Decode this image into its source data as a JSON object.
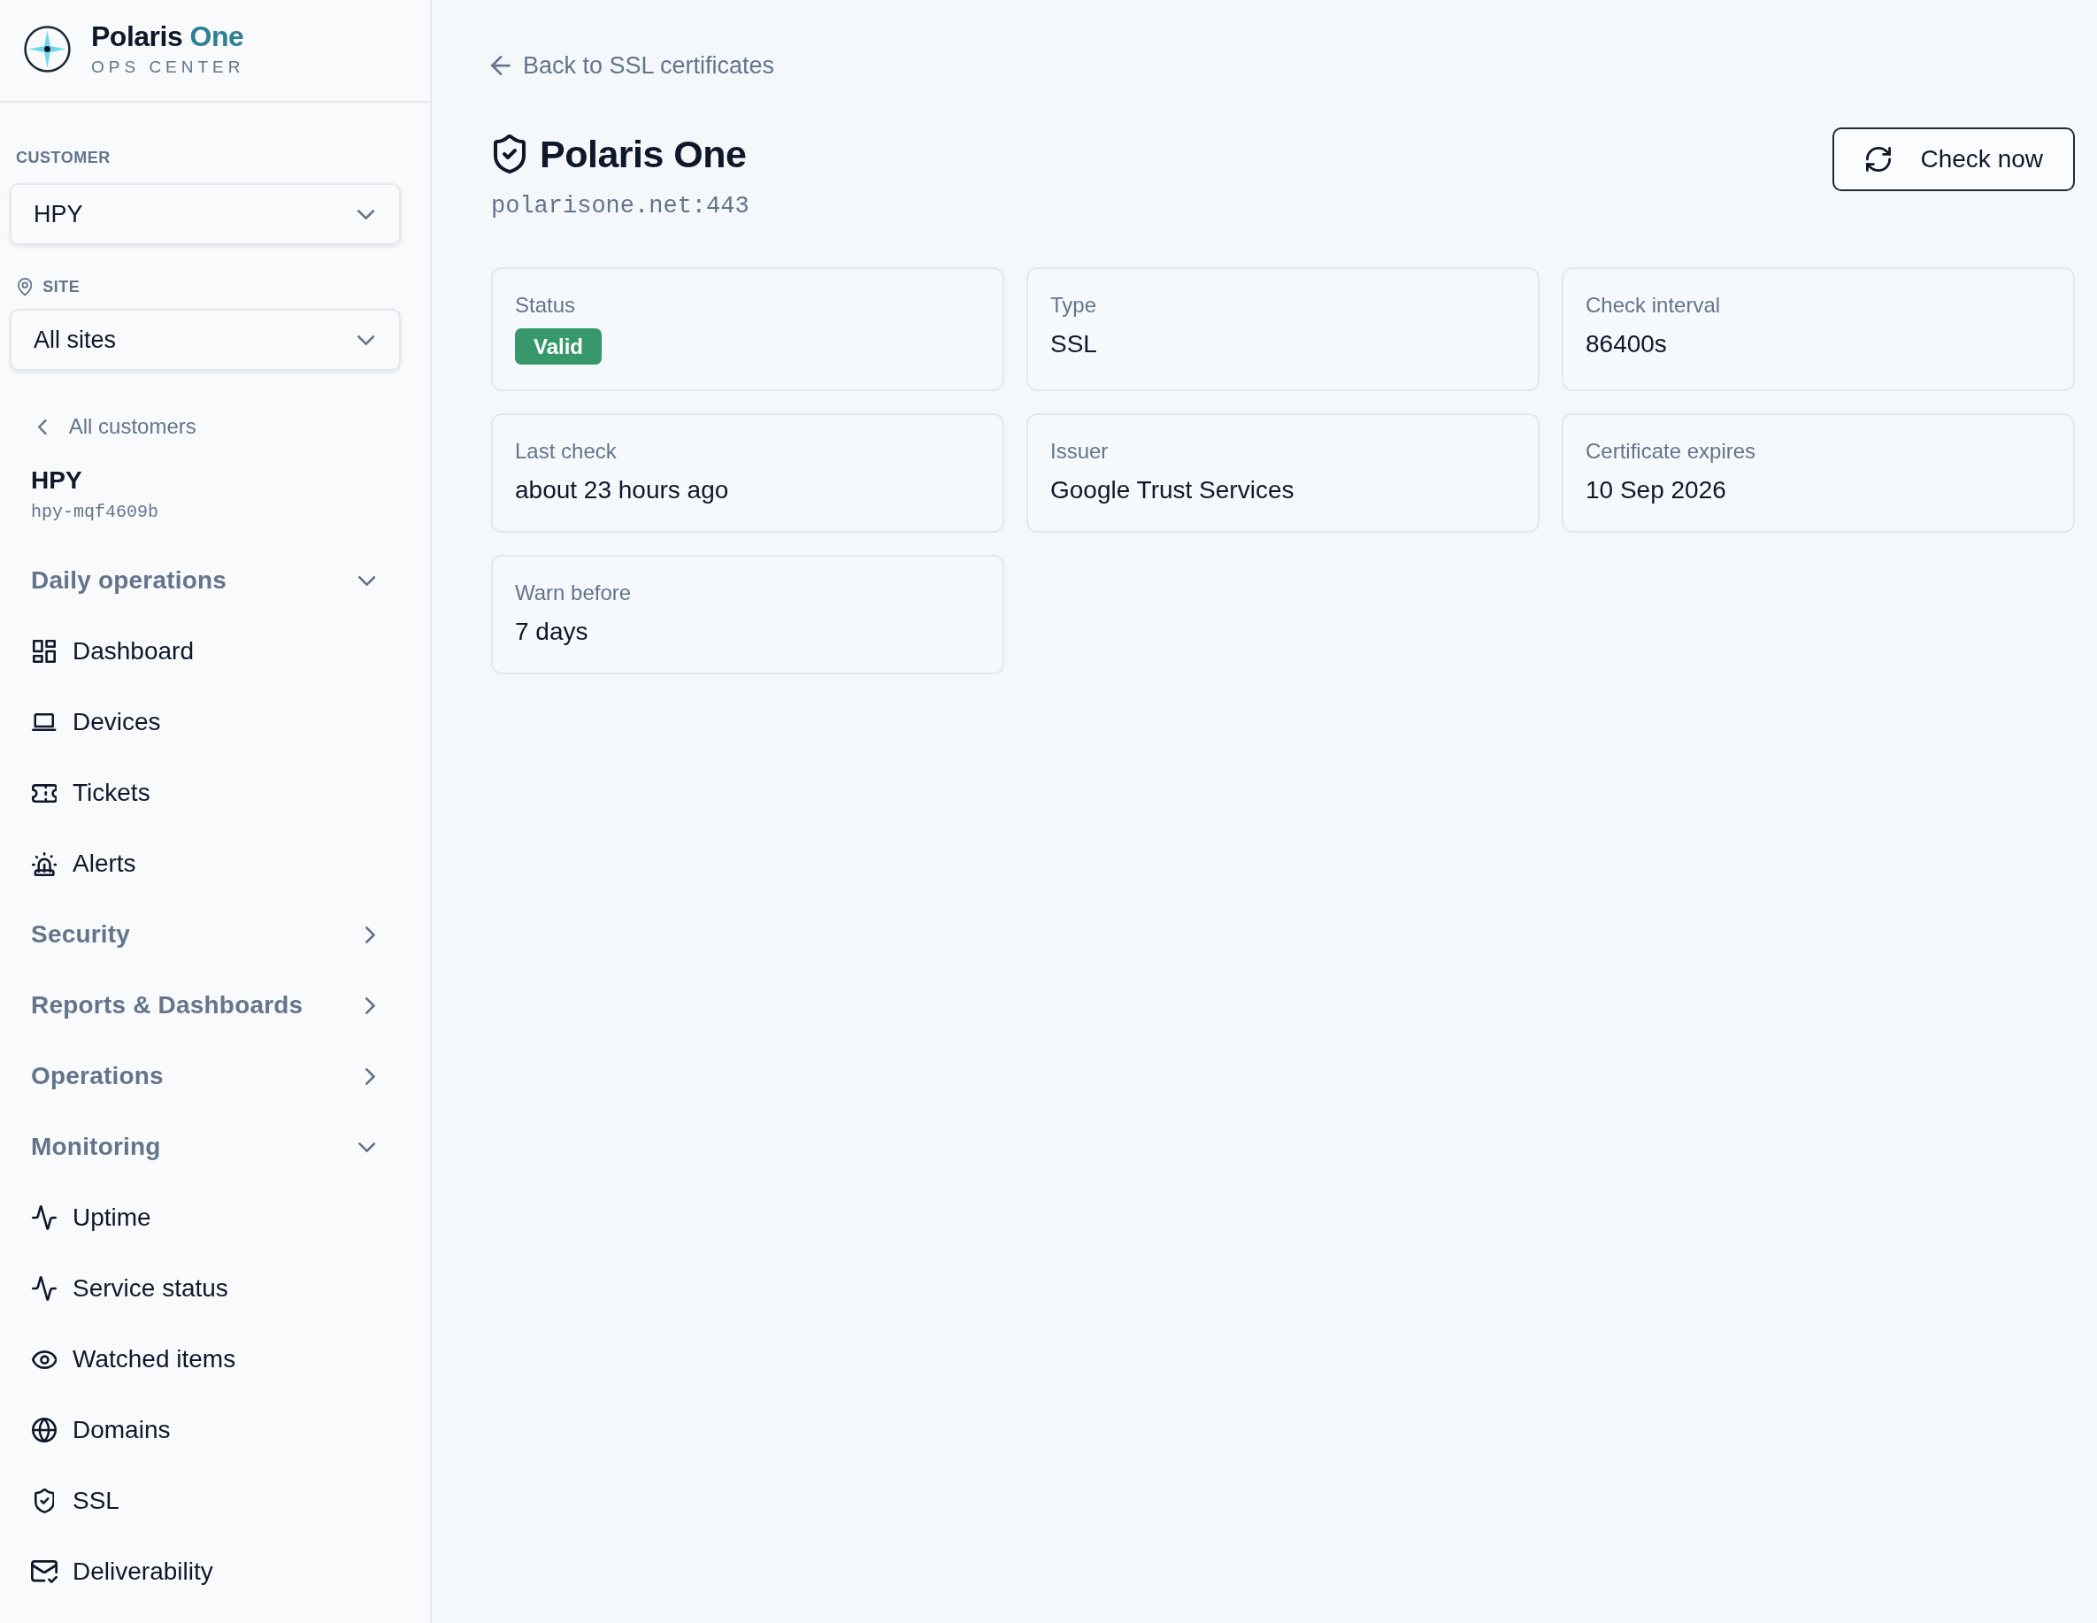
{
  "sidebar": {
    "brand": {
      "name": "Polaris",
      "accent": "One",
      "subtitle": "OPS CENTER"
    },
    "customer_select": {
      "label": "CUSTOMER",
      "value": "HPY"
    },
    "site_select": {
      "label": "SITE",
      "value": "All sites"
    },
    "customer": {
      "back_link": "All customers",
      "name": "HPY",
      "id": "hpy-mqf4609b"
    },
    "nav": [
      {
        "label": "Daily operations",
        "expanded": true,
        "children": [
          {
            "label": "Dashboard",
            "selected": false
          },
          {
            "label": "Devices",
            "selected": false
          },
          {
            "label": "Tickets",
            "selected": false
          },
          {
            "label": "Alerts",
            "selected": false
          }
        ]
      },
      {
        "label": "Security",
        "expanded": false
      },
      {
        "label": "Reports & Dashboards",
        "expanded": false
      },
      {
        "label": "Operations",
        "expanded": false
      },
      {
        "label": "Monitoring",
        "expanded": true,
        "children": [
          {
            "label": "Uptime",
            "selected": false
          },
          {
            "label": "Service status",
            "selected": false
          },
          {
            "label": "Watched items",
            "selected": false
          },
          {
            "label": "Domains",
            "selected": false
          },
          {
            "label": "SSL",
            "selected": false
          },
          {
            "label": "Deliverability",
            "selected": false
          }
        ]
      }
    ]
  },
  "header": {
    "back_link": "Back to SSL certificates",
    "title": "Polaris One",
    "host": "polarisone.net:443",
    "button": "Check now"
  },
  "details": [
    {
      "label": "Status",
      "kind": "badge",
      "value": "Valid"
    },
    {
      "label": "Type",
      "kind": "text",
      "value": "SSL"
    },
    {
      "label": "Check interval",
      "kind": "text",
      "value": "86400s"
    },
    {
      "label": "Last check",
      "kind": "text",
      "value": "about 23 hours ago"
    },
    {
      "label": "Issuer",
      "kind": "text",
      "value": "Google Trust Services"
    },
    {
      "label": "Certificate expires",
      "kind": "text",
      "value": "10 Sep 2026"
    },
    {
      "label": "Warn before",
      "kind": "text",
      "value": "7 days"
    }
  ]
}
